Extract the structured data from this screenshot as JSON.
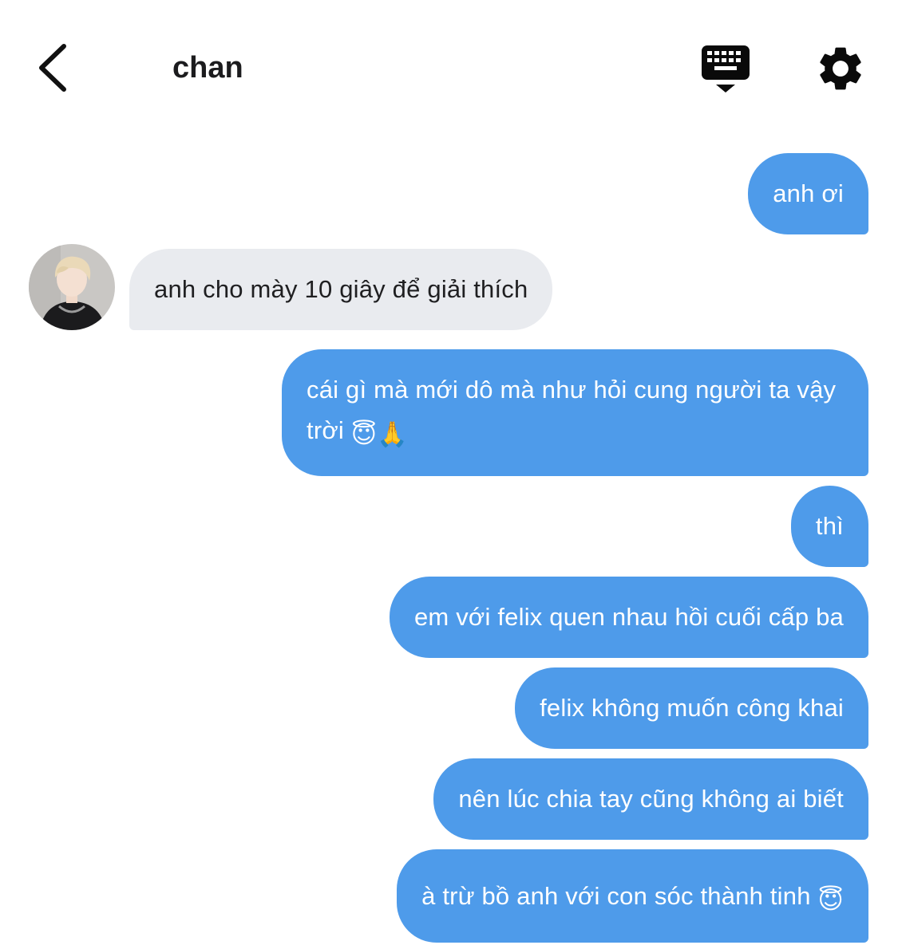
{
  "header": {
    "title": "chan",
    "back_icon": "chevron-left-icon",
    "keyboard_icon": "keyboard-hide-icon",
    "settings_icon": "gear-icon"
  },
  "colors": {
    "sent_bubble": "#4e9bea",
    "received_bubble": "#e9ebef",
    "title_text": "#1c1c1e"
  },
  "messages": [
    {
      "from": "me",
      "text": "anh ơi"
    },
    {
      "from": "chan",
      "text": "anh cho mày 10 giây để giải thích"
    },
    {
      "from": "me",
      "text": "cái gì mà mới dô mà như hỏi cung người ta vậy trời",
      "emojis": [
        "😇",
        "🙏"
      ]
    },
    {
      "from": "me",
      "text": "thì"
    },
    {
      "from": "me",
      "text": "em với felix quen nhau hồi cuối cấp ba"
    },
    {
      "from": "me",
      "text": "felix không muốn công khai"
    },
    {
      "from": "me",
      "text": "nên lúc chia tay cũng không ai biết"
    },
    {
      "from": "me",
      "text": "à trừ bồ anh với con sóc thành tinh",
      "emojis": [
        "😇"
      ]
    }
  ]
}
